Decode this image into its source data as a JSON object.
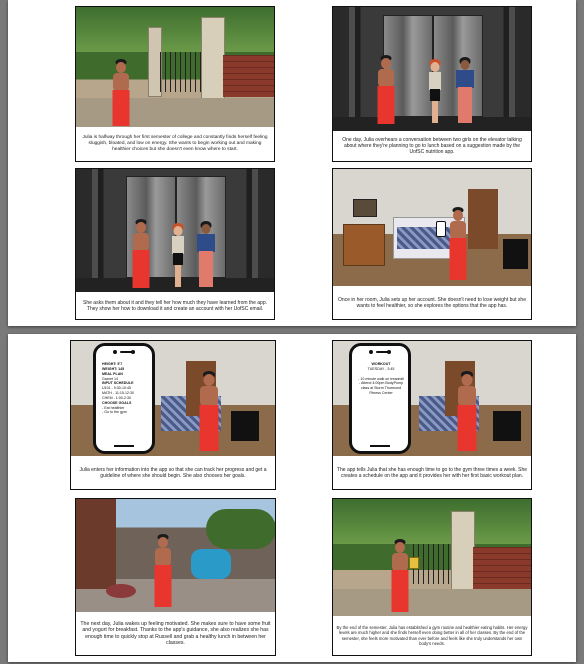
{
  "pages": [
    {
      "panels": [
        {
          "caption": "Julia is halfway through her first semester of college and constantly finds herself feeling sluggish, bloated, and low on energy. She wants to begin working out and making healthier choices but she doesn't even know where to start."
        },
        {
          "caption": "One day, Julia overhears a conversation between two girls on the elevator talking about where they're planning to go to lunch based on a suggestion made by the UofSC nutrition app."
        },
        {
          "caption": "She asks them about it and they tell her how much they have learned from the app. They show her how to download it and create an account with her UofSC email."
        },
        {
          "caption": "Once in her room, Julia sets up her account. She doesn't need to lose weight but she wants to feel healthier, so she explores the options that the app has."
        }
      ]
    },
    {
      "panels": [
        {
          "caption": "Julia enters her information into the app so that she can track her progress and get a guideline of where she should begin. She also chooses her goals.",
          "phone": [
            {
              "text": "HEIGHT: 5'7",
              "bold": true
            },
            {
              "text": "WEIGHT: 145",
              "bold": true
            },
            {
              "text": "MEAL PLAN",
              "bold": true
            },
            {
              "text": "Garnet 14",
              "bold": false
            },
            {
              "text": "INPUT SCHEDULE",
              "bold": true
            },
            {
              "text": "U101 - 9:30-10:45",
              "bold": false
            },
            {
              "text": "MATH - 11:15-12:30",
              "bold": false
            },
            {
              "text": "CHEM - 1:00-2:30",
              "bold": false
            },
            {
              "text": "CHOOSE GOALS",
              "bold": true
            },
            {
              "text": "- Eat healthier",
              "bold": false
            },
            {
              "text": "- Go to the gym",
              "bold": false
            }
          ]
        },
        {
          "caption": "The app tells Julia that she has enough time to go to the gym three times a week. She creates a schedule on the app and it provides her with her first basic workout plan.",
          "phone": [
            {
              "text": "WORKOUT",
              "bold": true
            },
            {
              "text": "TUESDAY - 3:45",
              "bold": false
            },
            {
              "text": "",
              "bold": false
            },
            {
              "text": "- 10 minute walk on treadmill",
              "bold": false
            },
            {
              "text": "- Attend 4:00pm BodyPump class at Storm Thurmond Fitness Center",
              "bold": false
            }
          ]
        },
        {
          "caption": "The next day, Julia wakes up feeling motivated. She makes sure to have some fruit and yogurt for breakfast. Thanks to the app's guidance, she also realizes she has enough time to quickly stop at Russell and grab a healthy lunch in between her classes."
        },
        {
          "caption": "By the end of the semester, Julia has established a gym routine and healthier eating habits. Her energy levels are much higher and she finds herself even doing better in all of her classes. By the end of the semester, she feels more motivated than ever before and feels like she truly understands her own body's needs."
        }
      ]
    }
  ],
  "colors": {
    "julia_pants": "#e8362e",
    "julia_skin": "#b06a4e",
    "girl1_jacket": "#2e4b8a",
    "girl2_shirt": "#d8d0c0"
  }
}
